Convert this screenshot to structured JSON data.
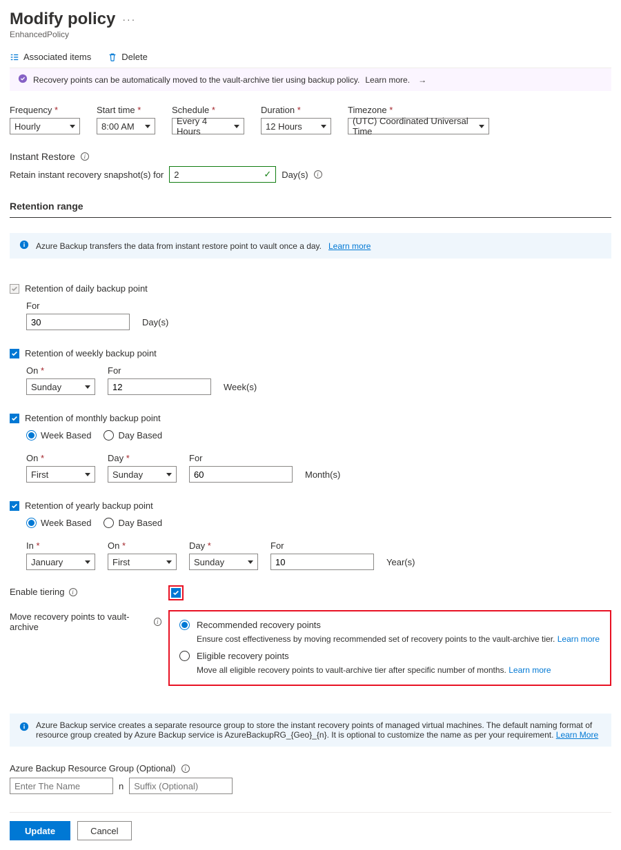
{
  "header": {
    "title": "Modify policy",
    "subtitle": "EnhancedPolicy"
  },
  "cmd": {
    "assoc": "Associated items",
    "del": "Delete"
  },
  "banner_archive": {
    "text": "Recovery points can be automatically moved to the vault-archive tier using backup policy.",
    "link": "Learn more."
  },
  "sched": {
    "freq_lbl": "Frequency",
    "freq_val": "Hourly",
    "start_lbl": "Start time",
    "start_val": "8:00 AM",
    "sch_lbl": "Schedule",
    "sch_val": "Every 4 Hours",
    "dur_lbl": "Duration",
    "dur_val": "12 Hours",
    "tz_lbl": "Timezone",
    "tz_val": "(UTC) Coordinated Universal Time"
  },
  "instant": {
    "heading": "Instant Restore",
    "retain_lbl": "Retain instant recovery snapshot(s) for",
    "value": "2",
    "unit": "Day(s)"
  },
  "ret_heading": "Retention range",
  "info_daily": {
    "text": "Azure Backup transfers the data from instant restore point to vault once a day.",
    "link": "Learn more"
  },
  "daily": {
    "chk": "Retention of daily backup point",
    "for_lbl": "For",
    "for_val": "30",
    "unit": "Day(s)"
  },
  "weekly": {
    "chk": "Retention of weekly backup point",
    "on_lbl": "On",
    "on_val": "Sunday",
    "for_lbl": "For",
    "for_val": "12",
    "unit": "Week(s)"
  },
  "monthly": {
    "chk": "Retention of monthly backup point",
    "week_based": "Week Based",
    "day_based": "Day Based",
    "on_lbl": "On",
    "on_val": "First",
    "day_lbl": "Day",
    "day_val": "Sunday",
    "for_lbl": "For",
    "for_val": "60",
    "unit": "Month(s)"
  },
  "yearly": {
    "chk": "Retention of yearly backup point",
    "week_based": "Week Based",
    "day_based": "Day Based",
    "in_lbl": "In",
    "in_val": "January",
    "on_lbl": "On",
    "on_val": "First",
    "day_lbl": "Day",
    "day_val": "Sunday",
    "for_lbl": "For",
    "for_val": "10",
    "unit": "Year(s)"
  },
  "tiering": {
    "enable_lbl": "Enable tiering",
    "move_lbl": "Move recovery points to vault-archive",
    "rec_title": "Recommended recovery points",
    "rec_desc": "Ensure cost effectiveness by moving recommended set of recovery points to the vault-archive tier.",
    "elig_title": "Eligible recovery points",
    "elig_desc": "Move all eligible recovery points to vault-archive tier after specific number of months.",
    "learn": "Learn more"
  },
  "rg_info": {
    "text": "Azure Backup service creates a separate resource group to store the instant recovery points of managed virtual machines. The default naming format of resource group created by Azure Backup service is AzureBackupRG_{Geo}_{n}. It is optional to customize the name as per your requirement.",
    "link": "Learn More"
  },
  "rg": {
    "lbl": "Azure Backup Resource Group (Optional)",
    "name_ph": "Enter The Name",
    "sep": "n",
    "suffix_ph": "Suffix (Optional)"
  },
  "footer": {
    "update": "Update",
    "cancel": "Cancel"
  }
}
